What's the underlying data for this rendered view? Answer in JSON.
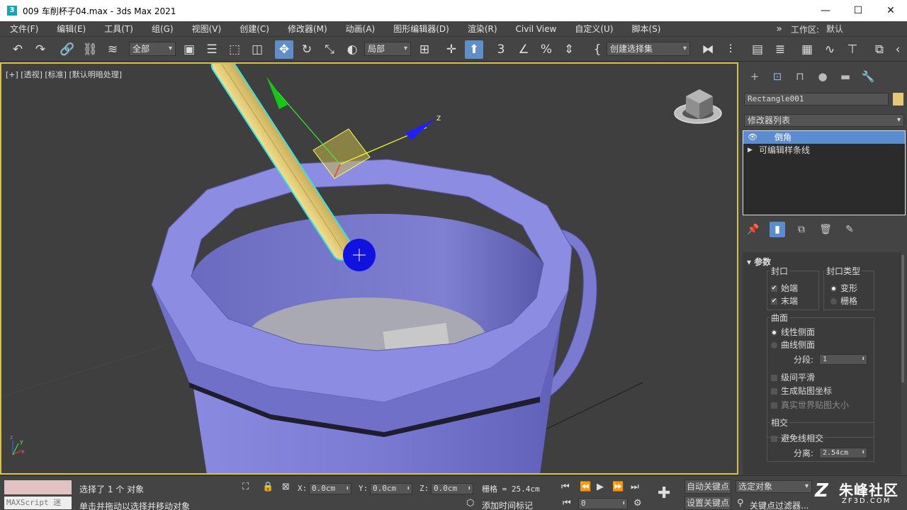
{
  "window": {
    "title": "009 车削杯子04.max - 3ds Max 2021",
    "app_icon_glyph": "3",
    "min_glyph": "—",
    "max_glyph": "☐",
    "close_glyph": "✕"
  },
  "menu": {
    "items": [
      "文件(F)",
      "编辑(E)",
      "工具(T)",
      "组(G)",
      "视图(V)",
      "创建(C)",
      "修改器(M)",
      "动画(A)",
      "图形编辑器(D)",
      "渲染(R)",
      "Civil View",
      "自定义(U)",
      "脚本(S)"
    ],
    "overflow_glyph": "»",
    "workspace_label": "工作区:",
    "workspace_value": "默认"
  },
  "toolbar": {
    "selection_filter": "全部",
    "ref_coord": "局部",
    "named_selection": "创建选择集",
    "icons": [
      "undo-icon",
      "redo-icon",
      "link-icon",
      "unlink-icon",
      "bind-spacewarp-icon",
      "select-object-icon",
      "select-by-name-icon",
      "rect-region-icon",
      "window-crossing-icon",
      "select-move-icon",
      "select-rotate-icon",
      "select-scale-icon",
      "placement-icon",
      "pivot-icon",
      "manipulate-icon",
      "snap-3d-icon",
      "angle-snap-icon",
      "percent-snap-icon",
      "spinner-snap-icon",
      "edit-named-sets-icon",
      "mirror-icon",
      "align-icon",
      "layers-icon",
      "scene-explorer-icon",
      "ribbon-icon",
      "curve-editor-icon",
      "schematic-icon",
      "material-editor-icon",
      "render-setup-icon",
      "render-frame-icon",
      "render-icon"
    ]
  },
  "viewport": {
    "label": "[+] [透视] [标准] [默认明暗处理]",
    "gizmo_axis_label": "Z",
    "axis_tripod": {
      "x": "x",
      "y": "y",
      "z": "z"
    },
    "colors": {
      "cup": "#7f7fd6",
      "rim": "#9494e6",
      "stick": "#e6cf7a",
      "gizmo_z": "#1a1aff",
      "gizmo_x": "#ffff00",
      "gizmo_y": "#00ff00",
      "bg": "#3f3f3f"
    }
  },
  "command_panel": {
    "tab_icons": [
      "create-tab-icon",
      "modify-tab-icon",
      "hierarchy-tab-icon",
      "motion-tab-icon",
      "display-tab-icon",
      "utilities-tab-icon"
    ],
    "object_name": "Rectangle001",
    "object_color": "#e3c877",
    "modifier_list": "修改器列表",
    "stack": [
      {
        "label": "倒角",
        "selected": true
      },
      {
        "label": "可编辑样条线",
        "selected": false
      }
    ],
    "params": {
      "rollout_title": "参数",
      "cap_group": "封口",
      "cap_start": "始端",
      "cap_end": "末端",
      "cap_type_group": "封口类型",
      "cap_morph": "变形",
      "cap_grid": "栅格",
      "surface_group": "曲面",
      "linear_sides": "线性侧面",
      "curved_sides": "曲线侧面",
      "segments_label": "分段:",
      "segments_value": "1",
      "smooth_across_levels": "级间平滑",
      "gen_map_coords": "生成贴图坐标",
      "real_world_map": "真实世界贴图大小",
      "intersections_group": "相交",
      "keep_lines": "避免线相交",
      "separation_label": "分离:",
      "separation_value": "2.54cm"
    }
  },
  "status": {
    "maxscript_label": "MAXScript 迷",
    "selected_text": "选择了 1 个 对象",
    "prompt_text": "单击并拖动以选择并移动对象",
    "x_label": "X:",
    "x_value": "0.0cm",
    "y_label": "Y:",
    "y_value": "0.0cm",
    "z_label": "Z:",
    "z_value": "0.0cm",
    "grid_text": "栅格 = 25.4cm",
    "add_time_tag": "添加时间标记",
    "auto_key": "自动关键点",
    "set_key": "设置关键点",
    "key_mode": "选定对象",
    "key_filters": "关键点过滤器...",
    "frame_value": "0"
  },
  "watermark": {
    "big": "朱峰社区",
    "small": "ZF3D.COM",
    "logo": "Z"
  }
}
